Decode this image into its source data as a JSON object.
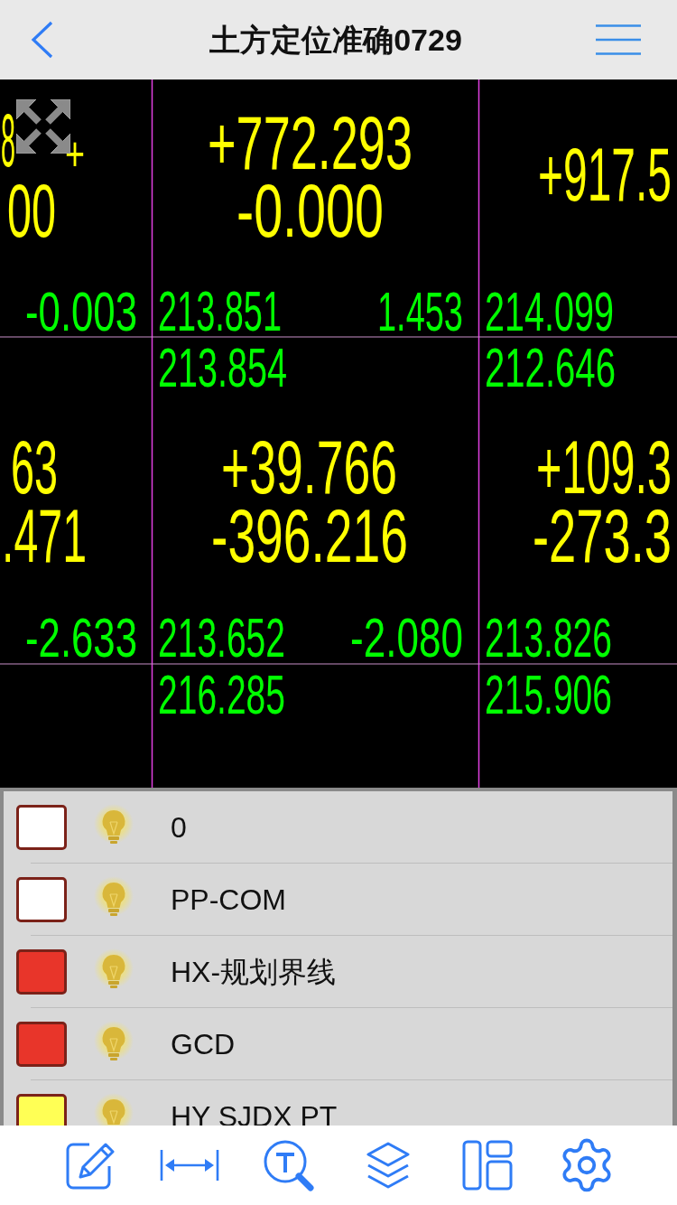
{
  "header": {
    "title": "土方定位准确0729"
  },
  "drawing": {
    "labels": [
      {
        "text": "8",
        "color": "#ffff00"
      },
      {
        "text": "+",
        "color": "#ffff00"
      },
      {
        "text": "00",
        "color": "#ffff00"
      },
      {
        "text": "+772.293",
        "color": "#ffff00"
      },
      {
        "text": "-0.000",
        "color": "#ffff00"
      },
      {
        "text": "+917.5",
        "color": "#ffff00"
      },
      {
        "text": "-0.003",
        "color": "#00ff00"
      },
      {
        "text": "213.851",
        "color": "#00ff00"
      },
      {
        "text": "1.453",
        "color": "#00ff00"
      },
      {
        "text": "214.099",
        "color": "#00ff00"
      },
      {
        "text": "213.854",
        "color": "#00ff00"
      },
      {
        "text": "212.646",
        "color": "#00ff00"
      },
      {
        "text": "63",
        "color": "#ffff00"
      },
      {
        "text": "+39.766",
        "color": "#ffff00"
      },
      {
        "text": "+109.3",
        "color": "#ffff00"
      },
      {
        "text": ".471",
        "color": "#ffff00"
      },
      {
        "text": "-396.216",
        "color": "#ffff00"
      },
      {
        "text": "-273.3",
        "color": "#ffff00"
      },
      {
        "text": "-2.633",
        "color": "#00ff00"
      },
      {
        "text": "213.652",
        "color": "#00ff00"
      },
      {
        "text": "-2.080",
        "color": "#00ff00"
      },
      {
        "text": "213.826",
        "color": "#00ff00"
      },
      {
        "text": "216.285",
        "color": "#00ff00"
      },
      {
        "text": "215.906",
        "color": "#00ff00"
      }
    ]
  },
  "layers": [
    {
      "name": "0",
      "color": "#ffffff",
      "visible": true
    },
    {
      "name": "PP-COM",
      "color": "#ffffff",
      "visible": true
    },
    {
      "name": "HX-规划界线",
      "color": "#e8352a",
      "visible": true
    },
    {
      "name": "GCD",
      "color": "#e8352a",
      "visible": true
    },
    {
      "name": "HY SJDX PT",
      "color": "#ffff55",
      "visible": true
    }
  ]
}
